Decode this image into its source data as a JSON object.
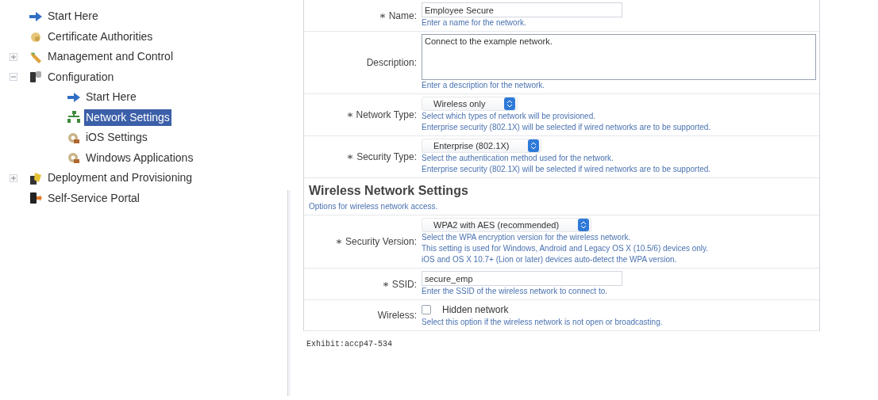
{
  "sidebar": {
    "items": [
      {
        "label": "Start Here",
        "kind": "arrow",
        "selected": false
      },
      {
        "label": "Certificate Authorities",
        "kind": "certificate",
        "selected": false
      },
      {
        "label": "Management and Control",
        "kind": "tools",
        "selected": false,
        "expanded": false
      },
      {
        "label": "Configuration",
        "kind": "device",
        "selected": false,
        "expanded": true,
        "children": [
          {
            "label": "Start Here",
            "kind": "arrow",
            "selected": false
          },
          {
            "label": "Network Settings",
            "kind": "network",
            "selected": true
          },
          {
            "label": "iOS Settings",
            "kind": "gear",
            "selected": false
          },
          {
            "label": "Windows Applications",
            "kind": "gear",
            "selected": false
          }
        ]
      },
      {
        "label": "Deployment and Provisioning",
        "kind": "package",
        "selected": false,
        "expanded": false
      },
      {
        "label": "Self-Service Portal",
        "kind": "portal",
        "selected": false
      }
    ]
  },
  "form": {
    "rows": [
      {
        "kind": "text",
        "label": "Name:",
        "required": true,
        "value": "Employee Secure",
        "hints": [
          "Enter a name for the network."
        ]
      },
      {
        "kind": "textarea",
        "label": "Description:",
        "required": false,
        "value": "Connect to the example network.",
        "hints": [
          "Enter a description for the network."
        ]
      },
      {
        "kind": "select",
        "label": "Network Type:",
        "required": true,
        "value": "Wireless only",
        "hints": [
          "Select which types of network will be provisioned.",
          "Enterprise security (802.1X) will be selected if wired networks are to be supported."
        ]
      },
      {
        "kind": "select",
        "label": "Security Type:",
        "required": true,
        "value": "Enterprise (802.1X)",
        "hints": [
          "Select the authentication method used for the network.",
          "Enterprise security (802.1X) will be selected if wired networks are to be supported."
        ]
      },
      {
        "kind": "section",
        "title": "Wireless Network Settings",
        "subtitle": "Options for wireless network access."
      },
      {
        "kind": "select",
        "label": "Security Version:",
        "required": true,
        "value": "WPA2 with AES (recommended)",
        "hints": [
          "Select the WPA encryption version for the wireless network.",
          "This setting is used for Windows, Android and Legacy OS X (10.5/6) devices only.",
          "iOS and OS X 10.7+ (Lion or later) devices auto-detect the WPA version."
        ]
      },
      {
        "kind": "text",
        "label": "SSID:",
        "required": true,
        "value": "secure_emp",
        "hints": [
          "Enter the SSID of the wireless network to connect to."
        ]
      },
      {
        "kind": "checkbox",
        "label": "Wireless:",
        "required": false,
        "value": "Hidden network",
        "checked": false,
        "hints": [
          "Select this option if the wireless network is not open or broadcasting."
        ]
      }
    ]
  },
  "caption": "Exhibit:accp47-534"
}
